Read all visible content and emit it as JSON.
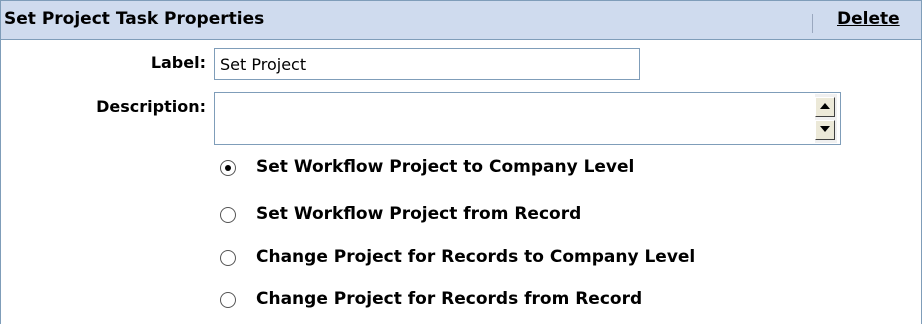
{
  "header": {
    "title": "Set Project Task Properties",
    "delete_label": "Delete"
  },
  "form": {
    "label_caption": "Label:",
    "label_value": "Set Project",
    "description_caption": "Description:",
    "description_value": ""
  },
  "options": [
    {
      "label": "Set Workflow Project to Company Level",
      "selected": true
    },
    {
      "label": "Set Workflow Project from Record",
      "selected": false
    },
    {
      "label": "Change Project for Records to Company Level",
      "selected": false
    },
    {
      "label": "Change Project for Records from Record",
      "selected": false
    }
  ]
}
